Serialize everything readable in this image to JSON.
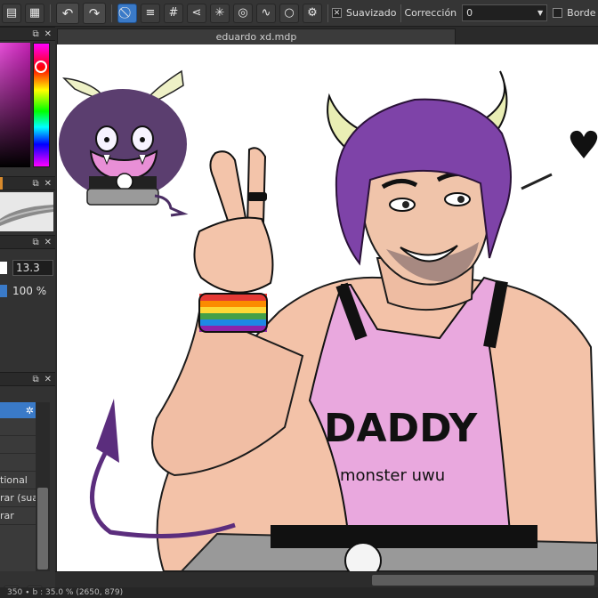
{
  "toolbar": {
    "antialias_label": "Suavizado",
    "antialias_checked": true,
    "correction_label": "Corrección",
    "correction_value": "0",
    "border_label": "Borde",
    "border_checked": false
  },
  "document": {
    "tab_title": "eduardo xd.mdp"
  },
  "brush_panel": {
    "size_value": "13.3",
    "opacity_value": "100 %"
  },
  "layer_panel": {
    "items": [
      "tional",
      "rar (sua",
      "rar"
    ]
  },
  "artwork": {
    "shirt_text_main": "DADDY",
    "shirt_text_sub": "monster uwu"
  },
  "status": {
    "text": "350 ∙ b : 35.0 % (2650, 879)"
  },
  "colors": {
    "app_bg": "#2b2b2b",
    "accent": "#3a7ac8",
    "canvas": "#ffffff"
  }
}
